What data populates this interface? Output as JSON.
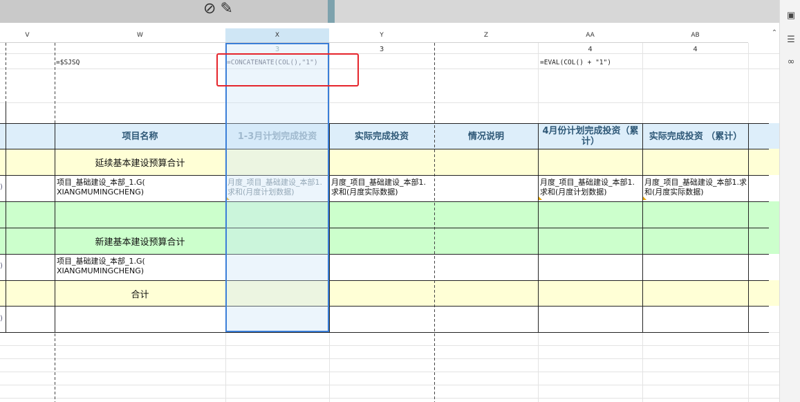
{
  "columns": [
    {
      "id": "V",
      "label": "V"
    },
    {
      "id": "W",
      "label": "W"
    },
    {
      "id": "X",
      "label": "X"
    },
    {
      "id": "Y",
      "label": "Y"
    },
    {
      "id": "Z",
      "label": "Z"
    },
    {
      "id": "AA",
      "label": "AA"
    },
    {
      "id": "AB",
      "label": "AB"
    }
  ],
  "row_numbers": {
    "X": "3",
    "Y": "3",
    "AA": "4",
    "AB": "4"
  },
  "formulas": {
    "W": "=$SJSQ",
    "X": "=CONCATENATE(COL(),\"1\")",
    "AA": "=EVAL(COL() + \"1\")"
  },
  "headers": {
    "W": "项目名称",
    "X": "1-3月计划完成投资",
    "Y": "实际完成投资",
    "Z": "情况说明",
    "AA": "4月份计划完成投资（累计）",
    "AB": "实际完成投资 （累计）"
  },
  "rows": {
    "r1_title": "延续基本建设预算合计",
    "r2_w": "项目_基础建设_本部_1.G( XIANGMUMINGCHENG)",
    "r2_x": "月度_项目_基础建设_本部1.求和(月度计划数据)",
    "r2_y": "月度_项目_基础建设_本部1.求和(月度实际数据)",
    "r2_aa": "月度_项目_基础建设_本部1.求和(月度计划数据)",
    "r2_ab": "月度_项目_基础建设_本部1.求和(月度实际数据)",
    "r4_title": "新建基本建设预算合计",
    "r5_w": "项目_基础建设_本部_1.G( XIANGMUMINGCHENG)",
    "r6_title": "合计"
  },
  "left_edge_marks": {
    "a": ")",
    "b": ")",
    "c": ")"
  },
  "colors": {
    "yellow_row": "#ffffd6",
    "green_row": "#ccffcc",
    "header_bg": "#ddeefa",
    "selection": "#3a7ed8",
    "highlight_box": "#e5242b"
  }
}
